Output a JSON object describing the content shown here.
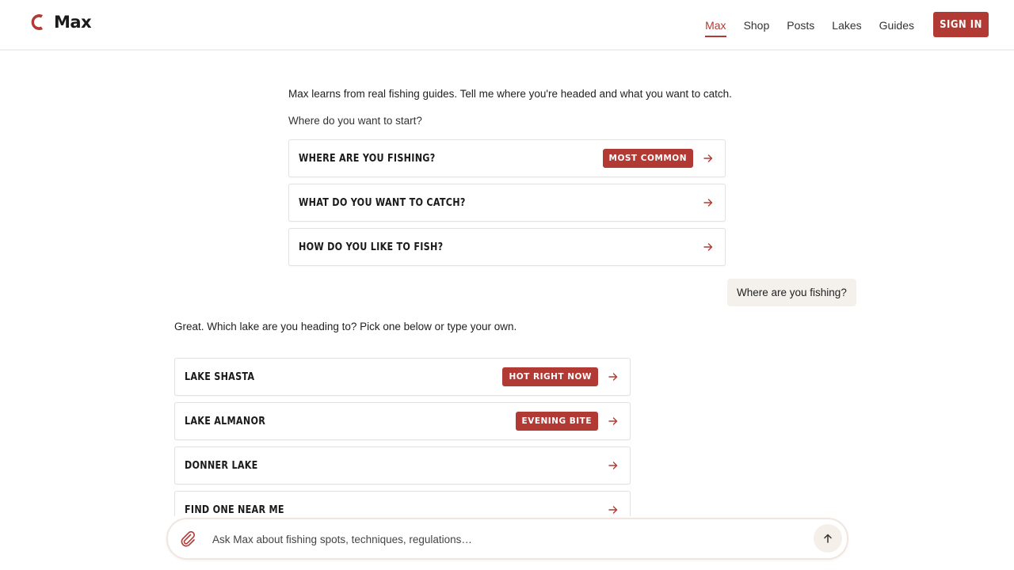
{
  "header": {
    "brand_name": "Max",
    "nav": [
      {
        "label": "Max",
        "active": true
      },
      {
        "label": "Shop",
        "active": false
      },
      {
        "label": "Posts",
        "active": false
      },
      {
        "label": "Lakes",
        "active": false
      },
      {
        "label": "Guides",
        "active": false
      }
    ],
    "signin_label": "SIGN IN"
  },
  "intro": {
    "text": "Max learns from real fishing guides. Tell me where you're headed and what you want to catch.",
    "prompt": "Where do you want to start?"
  },
  "start_options": [
    {
      "label": "WHERE ARE YOU FISHING?",
      "badge": "MOST COMMON"
    },
    {
      "label": "WHAT DO YOU WANT TO CATCH?",
      "badge": ""
    },
    {
      "label": "HOW DO YOU LIKE TO FISH?",
      "badge": ""
    }
  ],
  "user_message": "Where are you fishing?",
  "assistant_message": "Great. Which lake are you heading to? Pick one below or type your own.",
  "lake_options": [
    {
      "label": "LAKE SHASTA",
      "badge": "HOT RIGHT NOW"
    },
    {
      "label": "LAKE ALMANOR",
      "badge": "EVENING BITE"
    },
    {
      "label": "DONNER LAKE",
      "badge": ""
    },
    {
      "label": "FIND ONE NEAR ME",
      "badge": ""
    }
  ],
  "composer": {
    "placeholder": "Ask Max about fishing spots, techniques, regulations…"
  },
  "colors": {
    "accent": "#b23a35",
    "bubble_bg": "#f4f1ec",
    "border": "#e2e2e2"
  },
  "icons": {
    "logo": "crescent-logo-icon",
    "arrow": "arrow-right-icon",
    "attach": "paperclip-icon",
    "send": "arrow-up-icon"
  }
}
